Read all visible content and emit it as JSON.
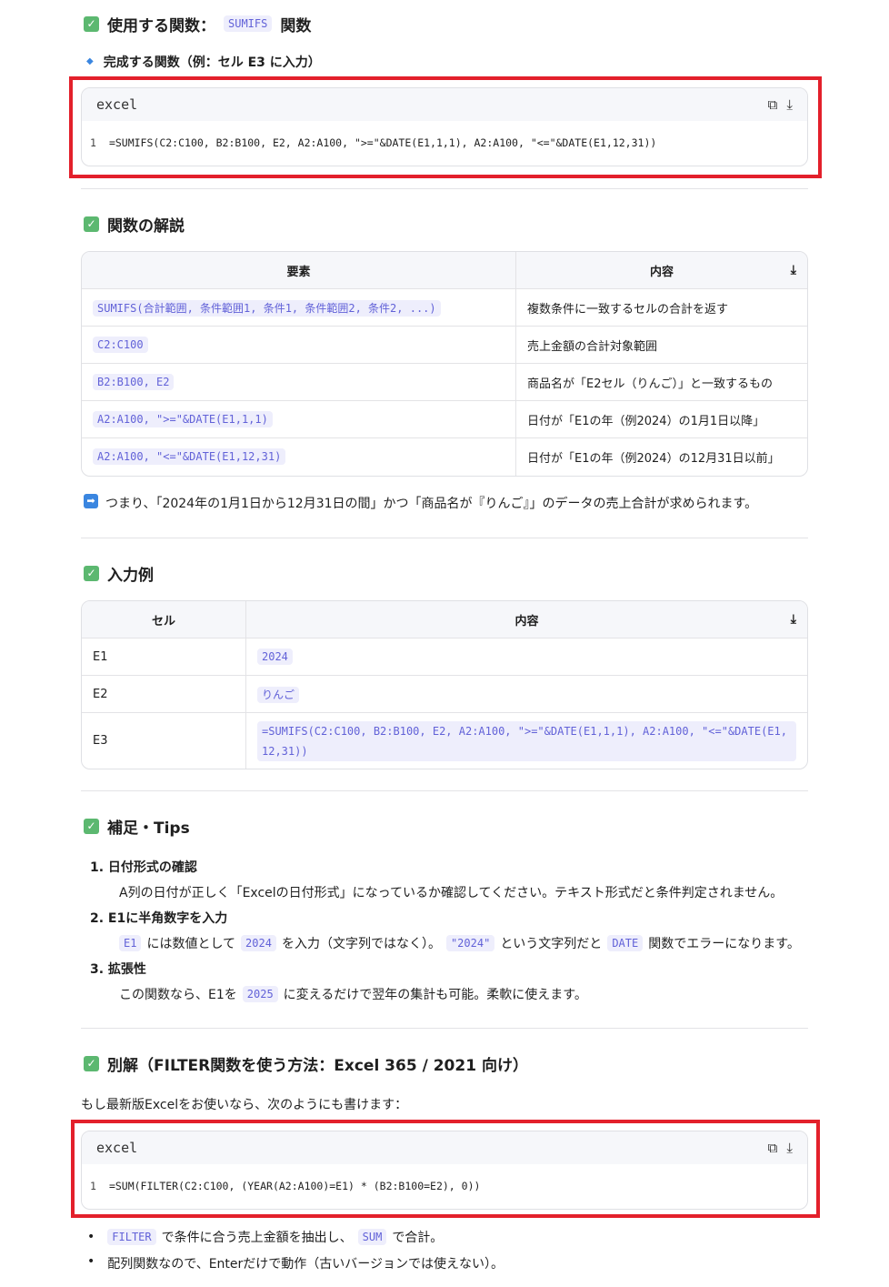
{
  "s1": {
    "heading": "使用する関数：",
    "code": "SUMIFS",
    "suffix": "関数",
    "bullet": "完成する関数（例：セル E3 に入力）"
  },
  "code1": {
    "lang": "excel",
    "line": "1",
    "text": "=SUMIFS(C2:C100, B2:B100, E2, A2:A100, \">=\"&DATE(E1,1,1), A2:A100, \"<=\"&DATE(E1,12,31))"
  },
  "s2": {
    "heading": "関数の解説",
    "headers": [
      "要素",
      "内容"
    ],
    "rows": [
      {
        "a": "SUMIFS(合計範囲, 条件範囲1, 条件1, 条件範囲2, 条件2, ...)",
        "b": "複数条件に一致するセルの合計を返す"
      },
      {
        "a": "C2:C100",
        "b": "売上金額の合計対象範囲"
      },
      {
        "a": "B2:B100, E2",
        "b": "商品名が「E2セル（りんご）」と一致するもの"
      },
      {
        "a": "A2:A100, \">=\"&DATE(E1,1,1)",
        "b": "日付が「E1の年（例2024）の1月1日以降」"
      },
      {
        "a": "A2:A100, \"<=\"&DATE(E1,12,31)",
        "b": "日付が「E1の年（例2024）の12月31日以前」"
      }
    ],
    "summary": "つまり、「2024年の1月1日から12月31日の間」かつ「商品名が『りんご』」のデータの売上合計が求められます。"
  },
  "s3": {
    "heading": "入力例",
    "headers": [
      "セル",
      "内容"
    ],
    "rows": [
      {
        "a": "E1",
        "b": "2024"
      },
      {
        "a": "E2",
        "b": "りんご"
      },
      {
        "a": "E3",
        "b": "=SUMIFS(C2:C100, B2:B100, E2, A2:A100, \">=\"&DATE(E1,1,1), A2:A100, \"<=\"&DATE(E1,12,31))"
      }
    ]
  },
  "s4": {
    "heading": "補足・Tips",
    "i1": "1. 日付形式の確認",
    "i1d": "A列の日付が正しく「Excelの日付形式」になっているか確認してください。テキスト形式だと条件判定されません。",
    "i2": "2. E1に半角数字を入力",
    "i2c1": "E1",
    "i2t1": "には数値として",
    "i2c2": "2024",
    "i2t2": "を入力（文字列ではなく）。",
    "i2c3": "\"2024\"",
    "i2t3": "という文字列だと",
    "i2c4": "DATE",
    "i2t4": "関数でエラーになります。",
    "i3": "3. 拡張性",
    "i3t1": "この関数なら、E1を",
    "i3c": "2025",
    "i3t2": "に変えるだけで翌年の集計も可能。柔軟に使えます。"
  },
  "s5": {
    "heading": "別解（FILTER関数を使う方法：Excel 365 / 2021 向け）",
    "para": "もし最新版Excelをお使いなら、次のようにも書けます：",
    "b1c1": "FILTER",
    "b1t1": "で条件に合う売上金額を抽出し、",
    "b1c2": "SUM",
    "b1t2": "で合計。",
    "b2": "配列関数なので、Enterだけで動作（古いバージョンでは使えない）。"
  },
  "code2": {
    "lang": "excel",
    "line": "1",
    "text": "=SUM(FILTER(C2:C100, (YEAR(A2:A100)=E1) * (B2:B100=E2), 0))"
  },
  "colors": {
    "accent": "#6262d8",
    "highlight": "#e3202b",
    "check": "#5cb870"
  }
}
